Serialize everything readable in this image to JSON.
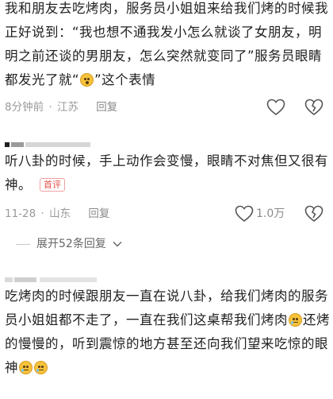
{
  "comment1": {
    "text_a": "我和朋友去吃烤肉，服务员小姐姐来给我们烤的时候我正好说到：“我也想不通我发小怎么就谈了女朋友，明明之前还谈的男朋友，怎么突然就变同了”服务员眼睛都发光了就“",
    "text_b": "”这个表情",
    "time": "8分钟前",
    "location": "江苏",
    "reply_label": "回复"
  },
  "comment2": {
    "text": "听八卦的时候，手上动作会变慢，眼睛不对焦但又很有神。",
    "badge": "首评",
    "date": "11-28",
    "location": "山东",
    "reply_label": "回复",
    "like_count": "1.0万"
  },
  "expand": {
    "label": "展开52条回复"
  },
  "comment3": {
    "text_a": "吃烤肉的时候跟朋友一直在说八卦，给我们烤肉的服务员小姐姐都不走了，一直在我们这桌帮我们烤肉",
    "text_b": "还烤的慢慢的，听到震惊的地方甚至还向我们望来吃惊的眼神"
  },
  "colors": {
    "text": "#1f1f1f",
    "meta": "#9a9a9a",
    "badge": "#e5504a"
  }
}
